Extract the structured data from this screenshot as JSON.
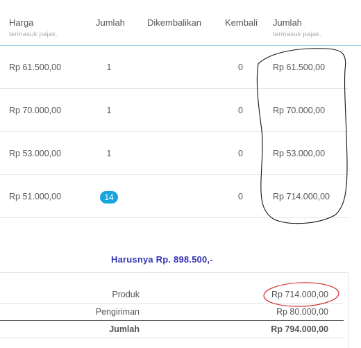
{
  "table": {
    "headers": {
      "price": "Harga",
      "price_sub": "termasuk pajak.",
      "qty": "Jumlah",
      "returned": "Dikembalikan",
      "change": "Kembali",
      "total": "Jumlah",
      "total_sub": "termasuk pajak."
    },
    "rows": [
      {
        "price": "Rp 61.500,00",
        "qty": "1",
        "returned": "",
        "change": "0",
        "total": "Rp 61.500,00"
      },
      {
        "price": "Rp 70.000,00",
        "qty": "1",
        "returned": "",
        "change": "0",
        "total": "Rp 70.000,00"
      },
      {
        "price": "Rp 53.000,00",
        "qty": "1",
        "returned": "",
        "change": "0",
        "total": "Rp 53.000,00"
      },
      {
        "price": "Rp 51.000,00",
        "qty": "14",
        "returned": "",
        "change": "0",
        "total": "Rp 714.000,00"
      }
    ]
  },
  "annotation": {
    "note": "Harusnya Rp. 898.500,-"
  },
  "summary": {
    "products_label": "Produk",
    "products_value": "Rp 714.000,00",
    "shipping_label": "Pengiriman",
    "shipping_value": "Rp 80.000,00",
    "total_label": "Jumlah",
    "total_value": "Rp 794.000,00"
  },
  "colors": {
    "header_border": "#9fd6ea",
    "badge": "#18a4df",
    "note": "#3535b5",
    "marker_black": "#111111",
    "marker_red": "#cc2222"
  }
}
